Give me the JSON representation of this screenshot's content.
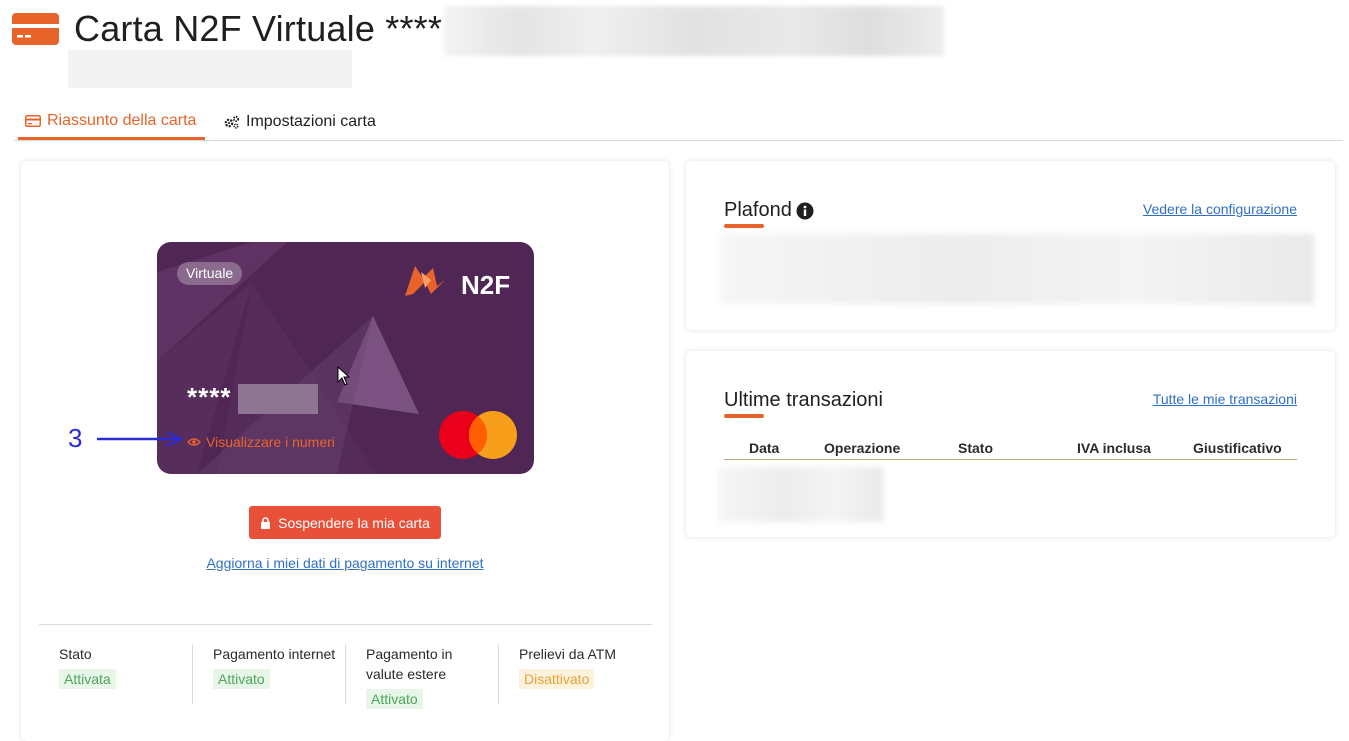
{
  "header": {
    "title": "Carta N2F Virtuale ****",
    "accent": "#e8632a"
  },
  "tabs": [
    {
      "label": "Riassunto della carta",
      "active": true,
      "icon": "credit-card-icon"
    },
    {
      "label": "Impostazioni carta",
      "active": false,
      "icon": "gears-icon"
    }
  ],
  "card": {
    "badge": "Virtuale",
    "brand": "N2F",
    "number": "****",
    "reveal_label": "Visualizzare i numeri",
    "background": "#4f2654",
    "network": "mastercard-logo"
  },
  "annotation": {
    "number": "3"
  },
  "actions": {
    "suspend_label": "Sospendere la mia carta",
    "update_label": "Aggiorna i miei dati di pagamento su internet"
  },
  "statuses": [
    {
      "label": "Stato",
      "value": "Attivata",
      "tone": "green"
    },
    {
      "label": "Pagamento internet",
      "value": "Attivato",
      "tone": "green"
    },
    {
      "label": "Pagamento in valute estere",
      "value": "Attivato",
      "tone": "green"
    },
    {
      "label": "Prelievi da ATM",
      "value": "Disattivato",
      "tone": "orange"
    }
  ],
  "plafond": {
    "title": "Plafond",
    "link": "Vedere la configurazione"
  },
  "transactions": {
    "title": "Ultime transazioni",
    "link": "Tutte le mie transazioni",
    "columns": [
      "Data",
      "Operazione",
      "Stato",
      "IVA inclusa",
      "Giustificativo"
    ]
  }
}
